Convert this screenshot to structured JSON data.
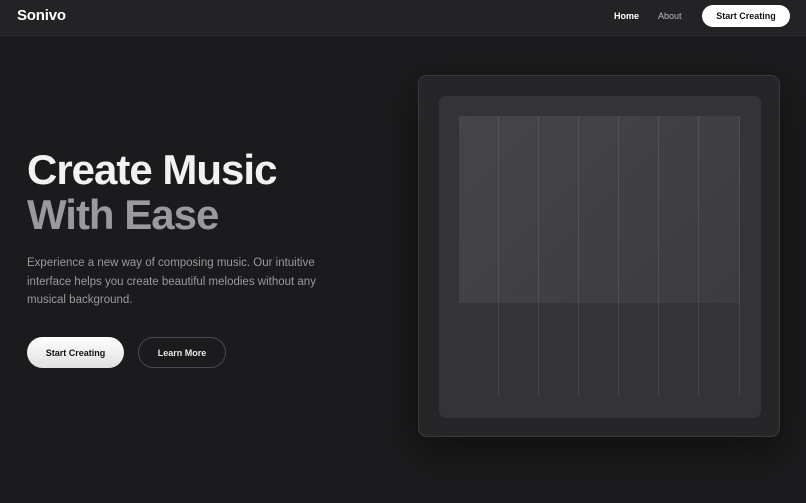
{
  "nav": {
    "brand": "Sonivo",
    "links": [
      "Home",
      "About"
    ],
    "cta": "Start Creating"
  },
  "hero": {
    "title_line1": "Create Music",
    "title_line2": "With Ease",
    "description": "Experience a new way of composing music. Our intuitive interface helps you create beautiful melodies without any musical background.",
    "primary_button": "Start Creating",
    "secondary_button": "Learn More"
  },
  "colors": {
    "background": "#1b1b1d",
    "nav_background": "#232325",
    "accent": "#ffffff",
    "muted_text": "#9a9a9d"
  }
}
